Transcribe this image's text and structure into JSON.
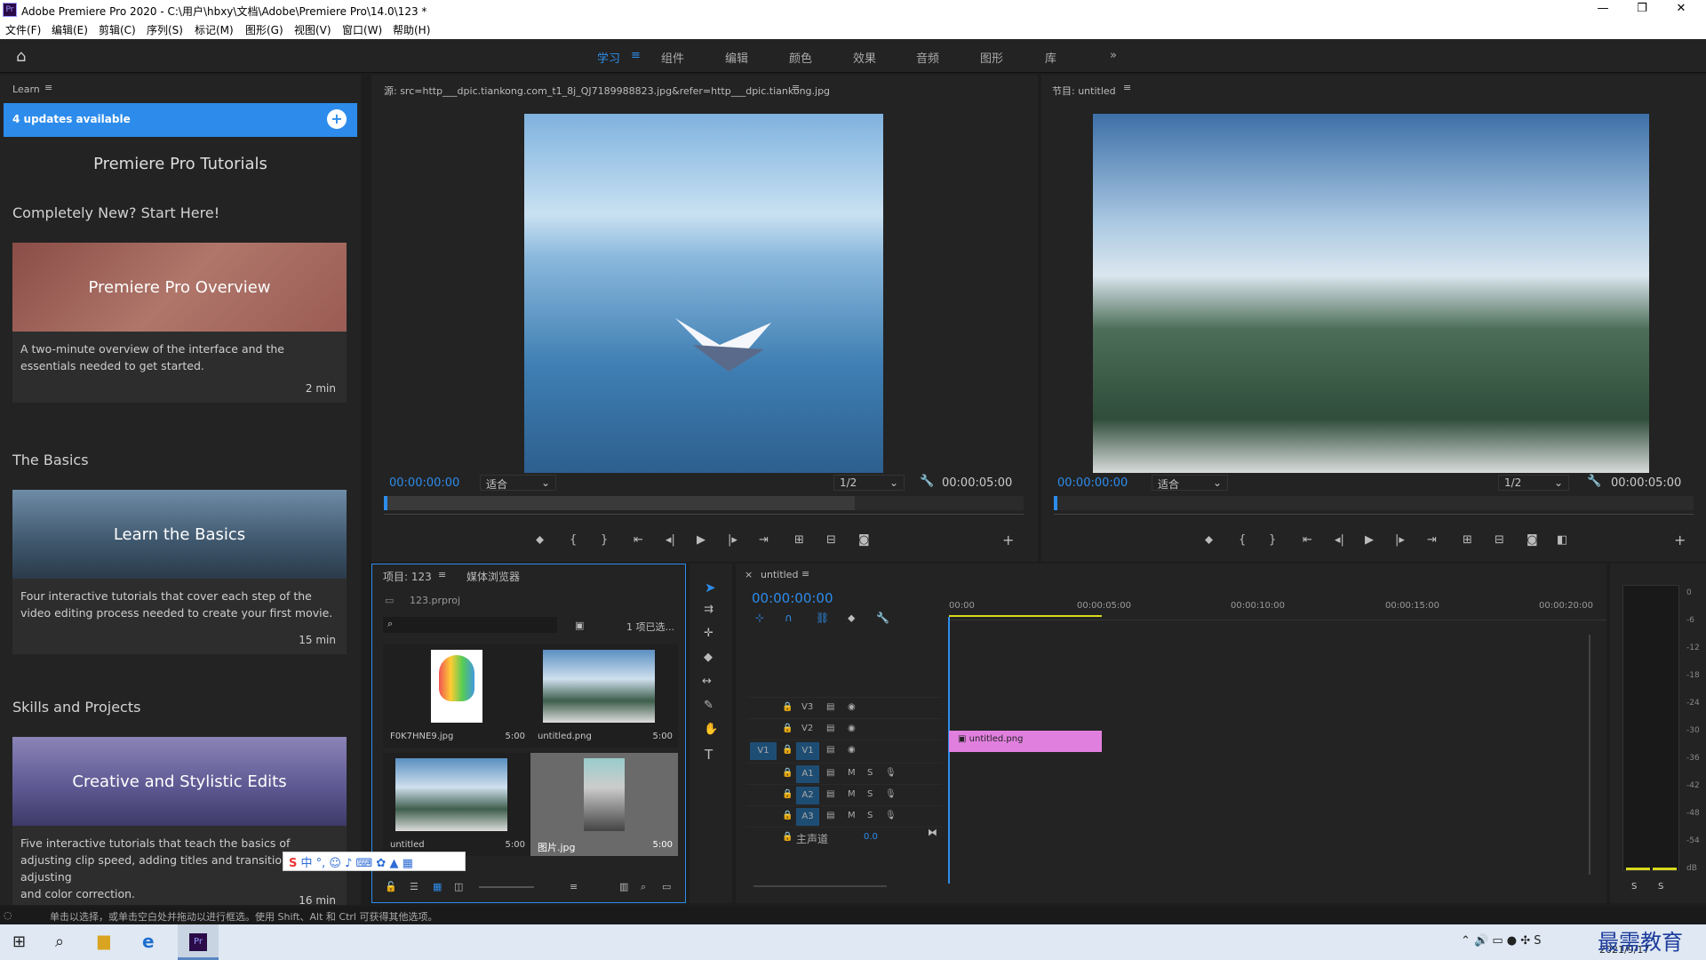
{
  "window": {
    "title": "Adobe Premiere Pro 2020 - C:\\用户\\hbxy\\文档\\Adobe\\Premiere Pro\\14.0\\123 *",
    "icon": "Pr"
  },
  "menu": [
    "文件(F)",
    "编辑(E)",
    "剪辑(C)",
    "序列(S)",
    "标记(M)",
    "图形(G)",
    "视图(V)",
    "窗口(W)",
    "帮助(H)"
  ],
  "workspaces": [
    "学习",
    "组件",
    "编辑",
    "颜色",
    "效果",
    "音频",
    "图形",
    "库"
  ],
  "learn": {
    "tab": "Learn",
    "updates": "4 updates available",
    "heading": "Premiere Pro Tutorials",
    "sections": [
      {
        "title": "Completely New? Start Here!",
        "card_title": "Premiere Pro Overview",
        "desc": "A two-minute overview of the interface and the essentials needed to get started.",
        "duration": "2 min"
      },
      {
        "title": "The Basics",
        "card_title": "Learn the Basics",
        "desc": "Four interactive tutorials that cover each step of the video editing process needed to create your first movie.",
        "duration": "15 min"
      },
      {
        "title": "Skills and Projects",
        "card_title": "Creative and Stylistic Edits",
        "desc": "Five interactive tutorials that teach the basics of adjusting clip speed, adding titles and transitions, adjusting",
        "desc2": "and color correction.",
        "duration": "16 min"
      }
    ]
  },
  "source": {
    "tab": "源: src=http___dpic.tiankong.com_t1_8j_QJ7189988823.jpg&refer=http___dpic.tiankong.jpg",
    "tc_in": "00:00:00:00",
    "fit": "适合",
    "res": "1/2",
    "tc_out": "00:00:05:00"
  },
  "program": {
    "tab": "节目: untitled",
    "tc_in": "00:00:00:00",
    "fit": "适合",
    "res": "1/2",
    "tc_out": "00:00:05:00"
  },
  "project": {
    "tab": "项目: 123",
    "tab2": "媒体浏览器",
    "file": "123.prproj",
    "selected": "1 项已选...",
    "items": [
      {
        "name": "F0K7HNE9.jpg",
        "dur": "5:00"
      },
      {
        "name": "untitled.png",
        "dur": "5:00"
      },
      {
        "name": "untitled",
        "dur": "5:00"
      },
      {
        "name": "图片.jpg",
        "dur": "5:00"
      }
    ]
  },
  "timeline": {
    "tab": "untitled",
    "tc": "00:00:00:00",
    "ruler": [
      "00:00",
      "00:00:05:00",
      "00:00:10:00",
      "00:00:15:00",
      "00:00:20:00"
    ],
    "video_tracks": [
      "V3",
      "V2",
      "V1"
    ],
    "audio_tracks": [
      "A1",
      "A2",
      "A3"
    ],
    "src_patch": "V1",
    "master": "主声道",
    "master_val": "0.0",
    "clip": "untitled.png",
    "m": "M",
    "s": "S"
  },
  "meter": {
    "ticks": [
      "0",
      "-6",
      "-12",
      "-18",
      "-24",
      "-30",
      "-36",
      "-42",
      "-48",
      "-54",
      "dB"
    ],
    "solo": [
      "S",
      "S"
    ]
  },
  "status": "单击以选择，或单击空白处并拖动以进行框选。使用 Shift、Alt 和 Ctrl 可获得其他选项。",
  "tray": {
    "date": "2021/9/17",
    "watermark": "最需教育"
  }
}
